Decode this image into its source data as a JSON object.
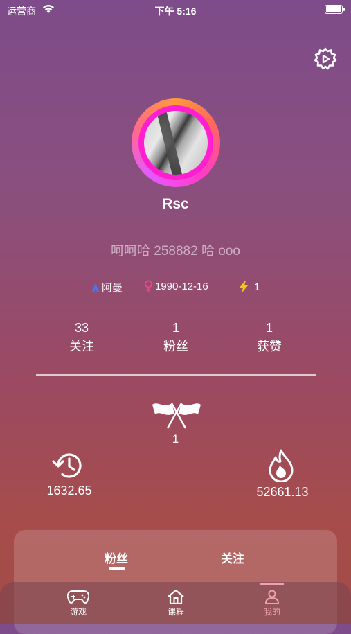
{
  "status_bar": {
    "carrier": "运营商",
    "time": "下午 5:16"
  },
  "profile": {
    "username": "Rsc",
    "bio": "呵呵哈 258882 哈 ooo",
    "meta": {
      "location_icon": "triangle-icon",
      "location": "阿曼",
      "gender_icon": "female-icon",
      "birthday": "1990-12-16",
      "level_icon": "lightning-icon",
      "level": "1"
    },
    "counts": [
      {
        "value": "33",
        "label": "关注"
      },
      {
        "value": "1",
        "label": "粉丝"
      },
      {
        "value": "1",
        "label": "获赞"
      }
    ],
    "flags_value": "1",
    "history_value": "1632.65",
    "fire_value": "52661.13"
  },
  "tabs": [
    {
      "label": "粉丝",
      "active": true
    },
    {
      "label": "关注",
      "active": false
    }
  ],
  "tabbar": [
    {
      "label": "游戏",
      "icon": "gamepad-icon"
    },
    {
      "label": "课程",
      "icon": "home-icon"
    },
    {
      "label": "我的",
      "icon": "user-icon",
      "active": true
    }
  ],
  "colors": {
    "accent_pink": "#ff1fd0",
    "active_tab_bar": "#f2a1b2",
    "location_blue": "#3a7bff",
    "gender_pink": "#e9438c",
    "lightning_yellow": "#f5c518"
  }
}
